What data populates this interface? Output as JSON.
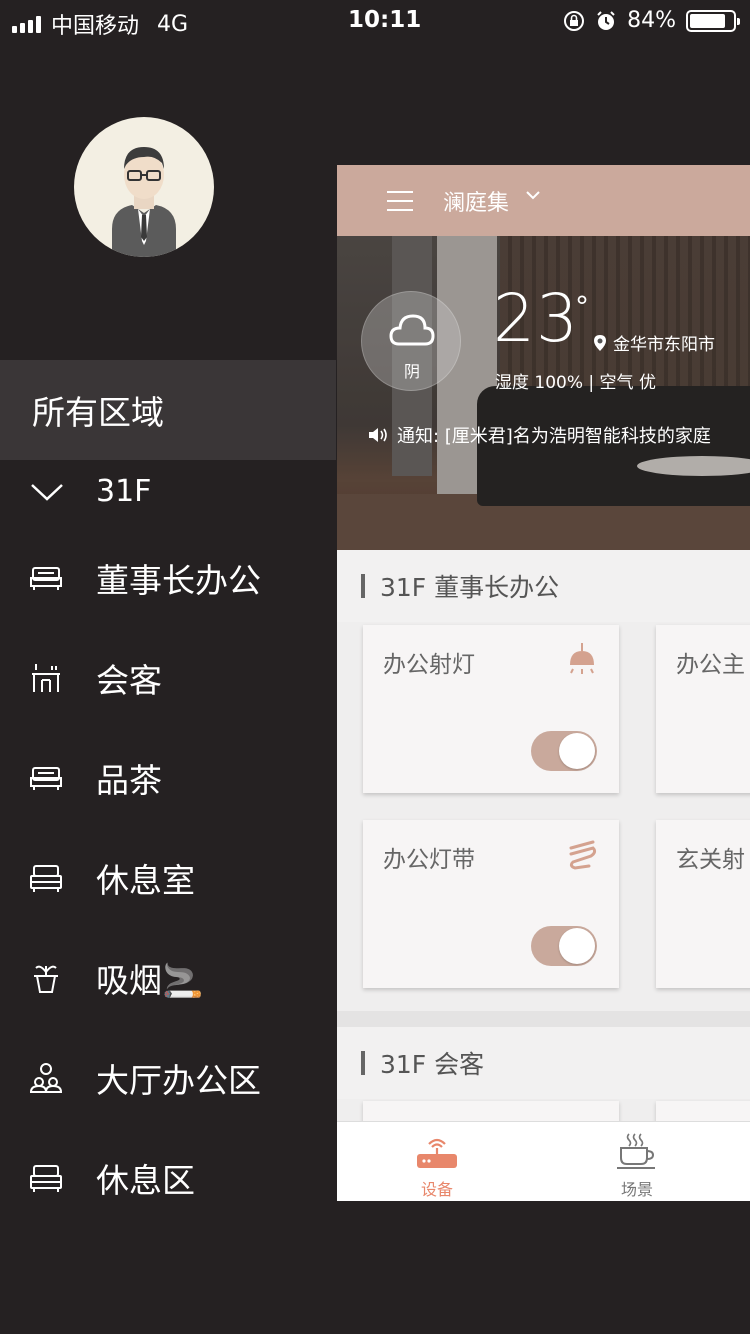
{
  "status_bar": {
    "carrier": "中国移动",
    "network": "4G",
    "time": "10:11",
    "battery": "84%"
  },
  "sidebar": {
    "all_regions": "所有区域",
    "floor": "31F",
    "items": [
      {
        "label": "董事长办公",
        "icon": "bed-icon"
      },
      {
        "label": "会客",
        "icon": "reception-icon"
      },
      {
        "label": "品茶",
        "icon": "bed-icon"
      },
      {
        "label": "休息室",
        "icon": "rest-bed-icon"
      },
      {
        "label": "吸烟🚬",
        "icon": "plant-icon"
      },
      {
        "label": "大厅办公区",
        "icon": "people-icon"
      },
      {
        "label": "休息区",
        "icon": "rest-bed-icon"
      }
    ]
  },
  "header": {
    "title": "澜庭集"
  },
  "weather": {
    "condition": "阴",
    "temperature": "23",
    "degree": "°",
    "location": "金华市东阳市",
    "humidity_line": "湿度 100%  |  空气 优",
    "notice": "通知:  [厘米君]名为浩明智能科技的家庭"
  },
  "sections": [
    {
      "title": "31F 董事长办公",
      "cards": [
        {
          "name": "办公射灯",
          "on": true
        },
        {
          "name": "办公主"
        },
        {
          "name": "办公灯带",
          "on": true
        },
        {
          "name": "玄关射"
        }
      ]
    },
    {
      "title": "31F 会客"
    }
  ],
  "tabs": [
    {
      "label": "设备",
      "active": true,
      "color": "#e8876b"
    },
    {
      "label": "场景",
      "active": false,
      "color": "#777777"
    }
  ]
}
